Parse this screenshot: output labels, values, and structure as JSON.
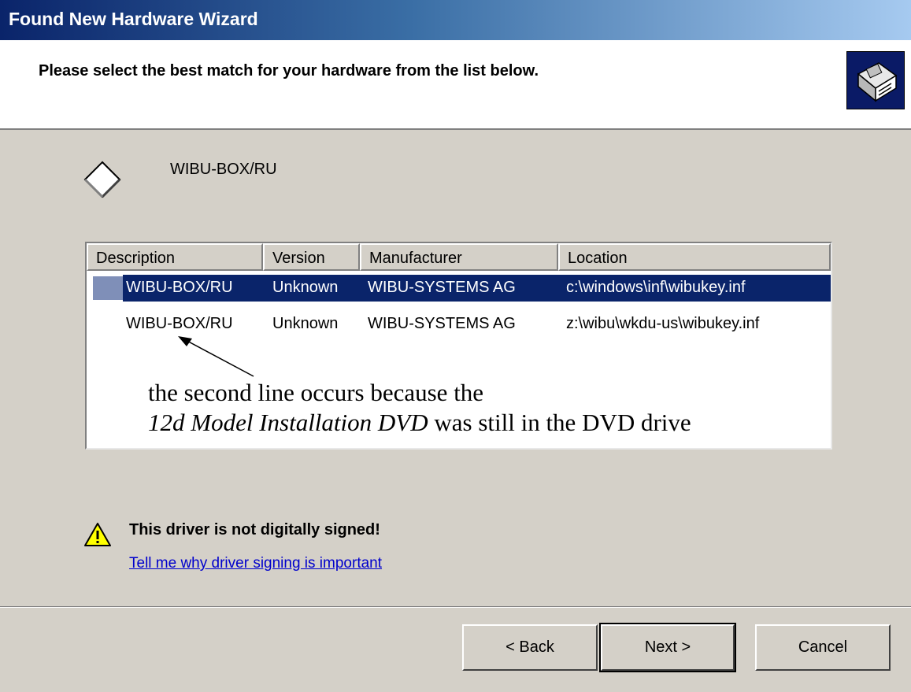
{
  "window": {
    "title": "Found New Hardware Wizard"
  },
  "header": {
    "heading": "Please select the best match for your hardware from the list below.",
    "icon": "hardware-wizard-icon"
  },
  "device": {
    "icon": "diamond-device-icon",
    "name": "WIBU-BOX/RU"
  },
  "driver_list": {
    "columns": [
      "Description",
      "Version",
      "Manufacturer",
      "Location"
    ],
    "rows": [
      {
        "description": "WIBU-BOX/RU",
        "version": "Unknown",
        "manufacturer": "WIBU-SYSTEMS AG",
        "location": "c:\\windows\\inf\\wibukey.inf",
        "selected": true
      },
      {
        "description": "WIBU-BOX/RU",
        "version": "Unknown",
        "manufacturer": "WIBU-SYSTEMS AG",
        "location": "z:\\wibu\\wkdu-us\\wibukey.inf",
        "selected": false
      }
    ]
  },
  "annotation": {
    "line1": "the second line occurs because the",
    "line2_italic": "12d Model Installation DVD",
    "line2_rest": " was still in the DVD drive"
  },
  "warning": {
    "icon": "warning-icon",
    "text": "This driver is not digitally signed!",
    "link": "Tell me why driver signing is important"
  },
  "buttons": {
    "back": "< Back",
    "next": "Next >",
    "cancel": "Cancel"
  }
}
